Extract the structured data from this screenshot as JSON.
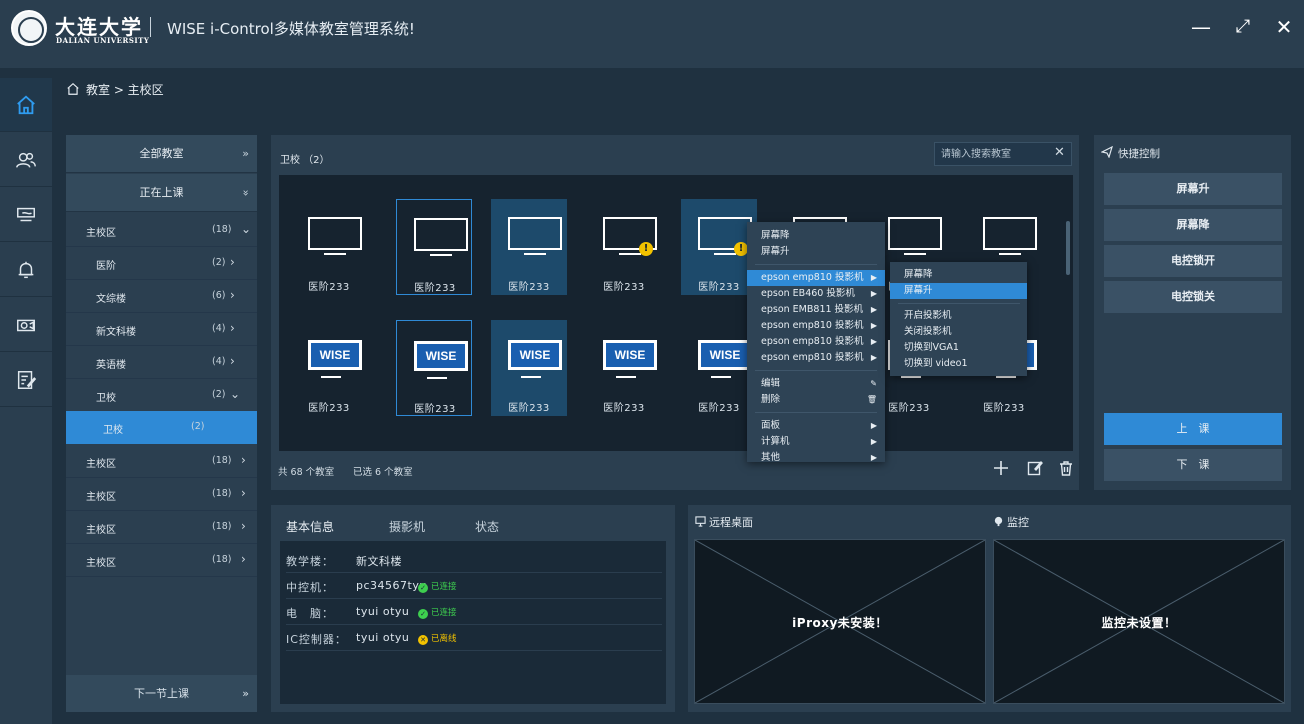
{
  "header": {
    "logo_text": "大连大学",
    "logo_sub": "DALIAN UNIVERSITY",
    "app_title": "WISE i-Control多媒体教室管理系统!",
    "min_icon": "—",
    "max_icon": "⤢",
    "close_icon": "✕"
  },
  "nav": [
    {
      "icon": "home-icon"
    },
    {
      "icon": "users-icon"
    },
    {
      "icon": "projector-hand-icon"
    },
    {
      "icon": "bell-icon"
    },
    {
      "icon": "camera-icon"
    },
    {
      "icon": "edit-doc-icon"
    }
  ],
  "breadcrumb": {
    "path": "教室 > 主校区"
  },
  "tree": {
    "all_label": "全部教室",
    "all_arrow": "»",
    "active_label": "正在上课",
    "active_arrow": "»",
    "rows": [
      {
        "label": "主校区",
        "count": "(18)",
        "chev": "⌄",
        "indent": 0
      },
      {
        "label": "医阶",
        "count": "(2)",
        "chev": "›",
        "indent": 1
      },
      {
        "label": "文综楼",
        "count": "(6)",
        "chev": "›",
        "indent": 1
      },
      {
        "label": "新文科楼",
        "count": "(4)",
        "chev": "›",
        "indent": 1
      },
      {
        "label": "英语楼",
        "count": "(4)",
        "chev": "›",
        "indent": 1
      },
      {
        "label": "卫校",
        "count": "(2)",
        "chev": "⌄",
        "indent": 1
      },
      {
        "label": "卫校",
        "count": "(2)",
        "chev": "",
        "indent": 2,
        "selected": true
      },
      {
        "label": "主校区",
        "count": "(18)",
        "chev": "›",
        "indent": 0
      },
      {
        "label": "主校区",
        "count": "(18)",
        "chev": "›",
        "indent": 0
      },
      {
        "label": "主校区",
        "count": "(18)",
        "chev": "›",
        "indent": 0
      },
      {
        "label": "主校区",
        "count": "(18)",
        "chev": "›",
        "indent": 0
      }
    ],
    "footer_label": "下一节上课",
    "footer_arrow": "»"
  },
  "rooms": {
    "title": "卫校 （2）",
    "search_placeholder": "请输入搜索教室",
    "clear_icon": "✕",
    "items": [
      {
        "label": "医阶233",
        "kind": "monitor",
        "state": "normal"
      },
      {
        "label": "医阶233",
        "kind": "monitor",
        "state": "outline"
      },
      {
        "label": "医阶233",
        "kind": "monitor",
        "state": "selected"
      },
      {
        "label": "医阶233",
        "kind": "monitor",
        "state": "normal",
        "warn": "!"
      },
      {
        "label": "医阶233",
        "kind": "monitor",
        "state": "selected",
        "warn": "!"
      },
      {
        "label": "医阶233",
        "kind": "monitor",
        "state": "normal"
      },
      {
        "label": "医阶233",
        "kind": "monitor",
        "state": "normal"
      },
      {
        "label": "医阶233",
        "kind": "monitor",
        "state": "normal"
      },
      {
        "label": "医阶233",
        "kind": "wise",
        "state": "normal",
        "logo": "WISE"
      },
      {
        "label": "医阶233",
        "kind": "wise",
        "state": "outline",
        "logo": "WISE"
      },
      {
        "label": "医阶233",
        "kind": "wise",
        "state": "selected",
        "logo": "WISE"
      },
      {
        "label": "医阶233",
        "kind": "wise",
        "state": "normal",
        "logo": "WISE"
      },
      {
        "label": "医阶233",
        "kind": "wise",
        "state": "normal",
        "logo": "WISE"
      },
      {
        "label": "医阶233",
        "kind": "wise",
        "state": "normal",
        "logo": "WISE"
      },
      {
        "label": "医阶233",
        "kind": "wise",
        "state": "normal",
        "logo": "WISE"
      },
      {
        "label": "医阶233",
        "kind": "wise",
        "state": "normal",
        "logo": "WISE"
      }
    ],
    "total_text": "共 68 个教室",
    "selected_text": "已选 6 个教室"
  },
  "context_menu": {
    "items": [
      {
        "label": "屏幕降"
      },
      {
        "label": "屏幕升"
      },
      {
        "sep": true
      },
      {
        "label": "epson emp810 投影机",
        "sub": "▶",
        "hl": true
      },
      {
        "label": "epson EB460 投影机",
        "sub": "▶"
      },
      {
        "label": "epson EMB811 投影机",
        "sub": "▶"
      },
      {
        "label": "epson emp810 投影机",
        "sub": "▶"
      },
      {
        "label": "epson emp810 投影机",
        "sub": "▶"
      },
      {
        "label": "epson emp810 投影机",
        "sub": "▶"
      },
      {
        "sep": true
      },
      {
        "label": "编辑",
        "sub": "✎"
      },
      {
        "label": "删除",
        "sub": "🗑"
      },
      {
        "sep": true
      },
      {
        "label": "面板",
        "sub": "▶"
      },
      {
        "label": "计算机",
        "sub": "▶"
      },
      {
        "label": "其他",
        "sub": "▶"
      }
    ],
    "submenu": [
      {
        "label": "屏幕降"
      },
      {
        "label": "屏幕升",
        "hl": true
      },
      {
        "sep": true
      },
      {
        "label": "开启投影机"
      },
      {
        "label": "关闭投影机"
      },
      {
        "label": "切换到VGA1"
      },
      {
        "label": "切换到 video1"
      }
    ]
  },
  "quick": {
    "title": "快捷控制",
    "buttons": [
      "屏幕升",
      "屏幕降",
      "电控锁开",
      "电控锁关"
    ],
    "start_label": "上　课",
    "end_label": "下　课"
  },
  "info": {
    "tabs": [
      "基本信息",
      "摄影机",
      "状态"
    ],
    "rows": [
      {
        "key": "教学楼：",
        "value": "新文科楼"
      },
      {
        "key": "中控机：",
        "value": "pc34567tyu",
        "status": "已连接",
        "status_color": "#3ecf4f",
        "status_icon": "✓"
      },
      {
        "key": "电　脑：",
        "value": "tyui otyu",
        "status": "已连接",
        "status_color": "#3ecf4f",
        "status_icon": "✓"
      },
      {
        "key": "IC控制器：",
        "value": "tyui otyu",
        "status": "已离线",
        "status_color": "#f2c200",
        "status_icon": "✕"
      }
    ]
  },
  "remote": {
    "desktop_title": "远程桌面",
    "desktop_msg": "iProxy未安装！",
    "monitor_title": "监控",
    "monitor_msg": "监控未设置！"
  }
}
